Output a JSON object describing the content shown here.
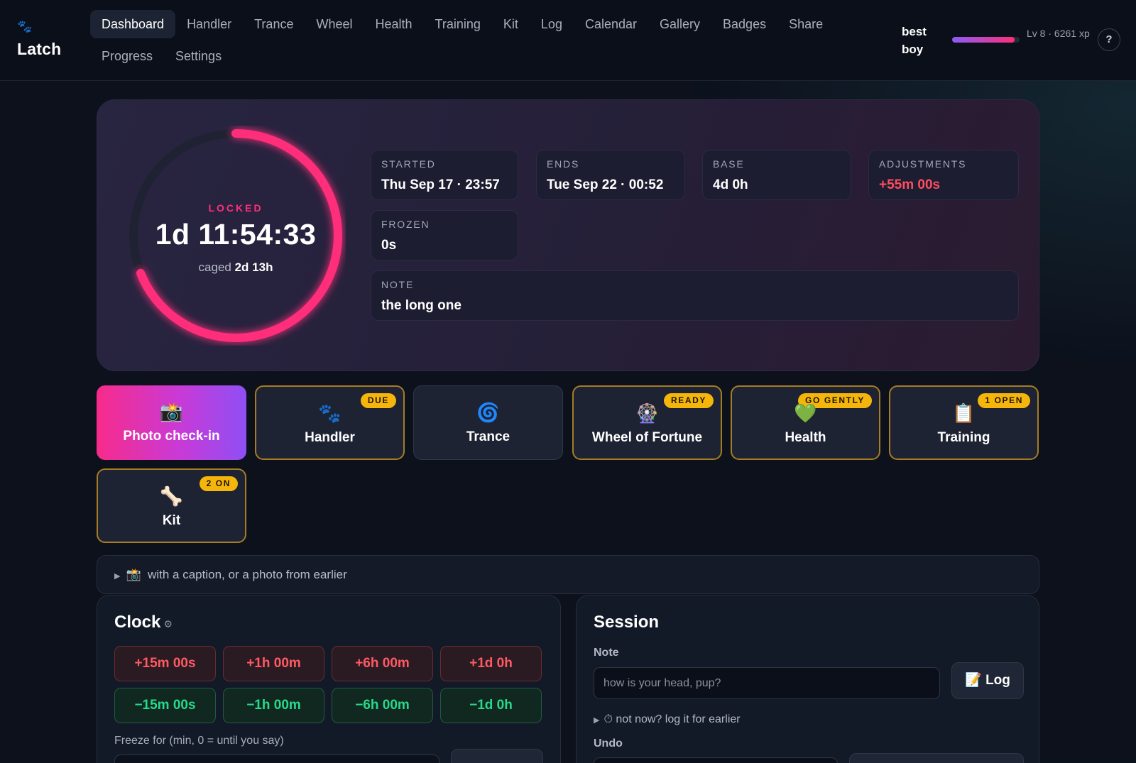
{
  "brand": {
    "icon": "paw-icon",
    "glyph": "🐾",
    "name": "Latch"
  },
  "nav": {
    "row1": [
      "Dashboard",
      "Handler",
      "Trance",
      "Wheel",
      "Health",
      "Training",
      "Kit",
      "Log",
      "Calendar",
      "Gallery",
      "Badges",
      "Share"
    ],
    "row2": [
      "Progress",
      "Settings"
    ],
    "active": "Dashboard"
  },
  "user": {
    "name": "best boy",
    "level": "Lv 8 · 6261 xp",
    "xp_progress": 0.93,
    "help_label": "?"
  },
  "hero": {
    "status": "LOCKED",
    "remaining": "1d 11:54:33",
    "caged_label": "caged",
    "caged_value": "2d 13h",
    "ring_progress": 0.69,
    "stats": {
      "started": {
        "label": "STARTED",
        "value": "Thu Sep 17 · 23:57"
      },
      "ends": {
        "label": "ENDS",
        "value": "Tue Sep 22 · 00:52"
      },
      "base": {
        "label": "BASE",
        "value": "4d 0h"
      },
      "adjustments": {
        "label": "ADJUSTMENTS",
        "value": "+55m 00s"
      },
      "frozen": {
        "label": "FROZEN",
        "value": "0s"
      },
      "note": {
        "label": "NOTE",
        "value": "the long one"
      }
    }
  },
  "tiles": [
    {
      "label": "Photo check-in",
      "icon": "camera-flash-icon",
      "glyph": "📸",
      "badge": ""
    },
    {
      "label": "Handler",
      "icon": "paw-icon",
      "glyph": "🐾",
      "badge": "DUE"
    },
    {
      "label": "Trance",
      "icon": "spiral-icon",
      "glyph": "🌀",
      "badge": ""
    },
    {
      "label": "Wheel of Fortune",
      "icon": "ferris-wheel-icon",
      "glyph": "🎡",
      "badge": "READY"
    },
    {
      "label": "Health",
      "icon": "green-heart-icon",
      "glyph": "💚",
      "badge": "GO GENTLY"
    },
    {
      "label": "Training",
      "icon": "clipboard-icon",
      "glyph": "📋",
      "badge": "1 OPEN"
    },
    {
      "label": "Kit",
      "icon": "bone-icon",
      "glyph": "🦴",
      "badge": "2 ON"
    }
  ],
  "caption_strip": {
    "icon": "camera-flash-icon",
    "glyph": "📸",
    "text": "with a caption, or a photo from earlier"
  },
  "clock": {
    "title": "Clock",
    "gear_glyph": "⚙",
    "plus": [
      "+15m 00s",
      "+1h 00m",
      "+6h 00m",
      "+1d 0h"
    ],
    "minus": [
      "−15m 00s",
      "−1h 00m",
      "−6h 00m",
      "−1d 0h"
    ],
    "freeze_label": "Freeze for (min, 0 = until you say)"
  },
  "session": {
    "title": "Session",
    "note_label": "Note",
    "note_placeholder": "how is your head, pup?",
    "log_glyph": "📝",
    "log_label": "Log",
    "later_text": "⏱ not now? log it for earlier",
    "undo_label": "Undo"
  },
  "colors": {
    "accent_pink": "#ff2d7a",
    "accent_purple": "#8b5cf6",
    "badge_gold": "#f5b50b",
    "plus_red": "#ff5a63",
    "minus_green": "#27d98a"
  }
}
